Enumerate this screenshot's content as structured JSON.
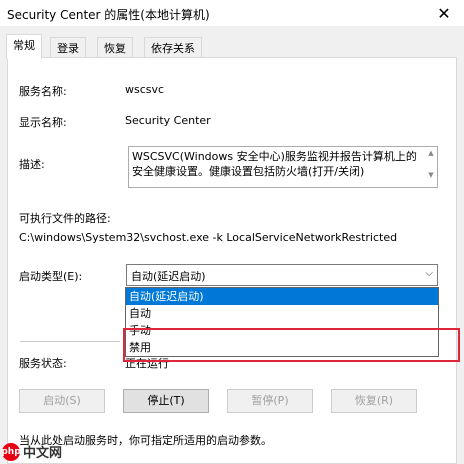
{
  "window": {
    "title": "Security Center 的属性(本地计算机)",
    "close_symbol": "✕"
  },
  "tabs": [
    {
      "label": "常规",
      "active": true
    },
    {
      "label": "登录",
      "active": false
    },
    {
      "label": "恢复",
      "active": false
    },
    {
      "label": "依存关系",
      "active": false
    }
  ],
  "general": {
    "service_name_label": "服务名称:",
    "service_name_value": "wscsvc",
    "display_name_label": "显示名称:",
    "display_name_value": "Security Center",
    "description_label": "描述:",
    "description_value": "WSCSVC(Windows 安全中心)服务监视并报告计算机上的安全健康设置。健康设置包括防火墙(打开/关闭)",
    "exe_path_label": "可执行文件的路径:",
    "exe_path_value": "C:\\windows\\System32\\svchost.exe -k LocalServiceNetworkRestricted",
    "startup_type_label": "启动类型(E):",
    "startup_type_value": "自动(延迟启动)",
    "startup_options": [
      {
        "label": "自动(延迟启动)",
        "selected": true
      },
      {
        "label": "自动",
        "selected": false
      },
      {
        "label": "手动",
        "selected": false
      },
      {
        "label": "禁用",
        "selected": false
      }
    ],
    "service_status_label": "服务状态:",
    "service_status_value": "正在运行",
    "buttons": [
      {
        "label": "启动(S)",
        "enabled": false
      },
      {
        "label": "停止(T)",
        "enabled": true
      },
      {
        "label": "暂停(P)",
        "enabled": false
      },
      {
        "label": "恢复(R)",
        "enabled": false
      }
    ],
    "hint_text": "当从此处启动服务时，你可指定所适用的启动参数。"
  },
  "watermark": {
    "logo_text": "php",
    "site_text": "中文网"
  },
  "colors": {
    "selection": "#0078d7",
    "highlight_border": "#e0263b"
  }
}
